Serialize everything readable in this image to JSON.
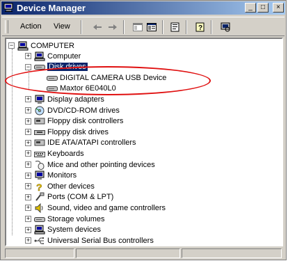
{
  "window": {
    "title": "Device Manager",
    "minimize_glyph": "_",
    "maximize_glyph": "□",
    "close_glyph": "×"
  },
  "menu": {
    "action": "Action",
    "view": "View"
  },
  "toolbar": {
    "icons": [
      "back-icon",
      "forward-icon",
      "console-tree-icon",
      "details-icon",
      "properties-icon",
      "help-icon",
      "scan-hardware-icon"
    ]
  },
  "tree": {
    "root": "COMPUTER",
    "items": [
      {
        "label": "Computer",
        "icon": "computer-icon",
        "expanded": false
      },
      {
        "label": "Disk drives",
        "icon": "disk-drive-icon",
        "expanded": true,
        "selected": true
      },
      {
        "label": "DIGITAL CAMERA USB Device",
        "icon": "disk-drive-icon",
        "child": true
      },
      {
        "label": "Maxtor 6E040L0",
        "icon": "disk-drive-icon",
        "child": true
      },
      {
        "label": "Display adapters",
        "icon": "monitor-icon",
        "expanded": false
      },
      {
        "label": "DVD/CD-ROM drives",
        "icon": "cdrom-icon",
        "expanded": false
      },
      {
        "label": "Floppy disk controllers",
        "icon": "controller-icon",
        "expanded": false
      },
      {
        "label": "Floppy disk drives",
        "icon": "floppy-icon",
        "expanded": false
      },
      {
        "label": "IDE ATA/ATAPI controllers",
        "icon": "controller-icon",
        "expanded": false
      },
      {
        "label": "Keyboards",
        "icon": "keyboard-icon",
        "expanded": false
      },
      {
        "label": "Mice and other pointing devices",
        "icon": "mouse-icon",
        "expanded": false
      },
      {
        "label": "Monitors",
        "icon": "monitor-icon",
        "expanded": false
      },
      {
        "label": "Other devices",
        "icon": "question-icon",
        "expanded": false
      },
      {
        "label": "Ports (COM & LPT)",
        "icon": "port-icon",
        "expanded": false
      },
      {
        "label": "Sound, video and game controllers",
        "icon": "speaker-icon",
        "expanded": false
      },
      {
        "label": "Storage volumes",
        "icon": "disk-drive-icon",
        "expanded": false
      },
      {
        "label": "System devices",
        "icon": "computer-icon",
        "expanded": false
      },
      {
        "label": "Universal Serial Bus controllers",
        "icon": "usb-icon",
        "expanded": false
      }
    ]
  },
  "annotation": {
    "color": "#e01010"
  }
}
